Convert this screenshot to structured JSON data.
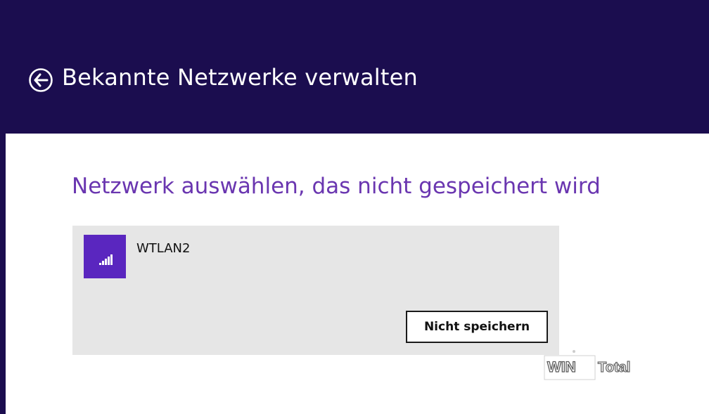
{
  "header": {
    "title": "Bekannte Netzwerke verwalten",
    "back_icon": "back-arrow-circle-icon",
    "background_color": "#1b0d4f"
  },
  "main": {
    "heading": "Netzwerk auswählen, das nicht gespeichert wird",
    "heading_color": "#6a36b0",
    "networks": [
      {
        "name": "WTLAN2",
        "icon": "wifi-signal-icon",
        "tile_color": "#5a26bf",
        "forget_label": "Nicht speichern"
      }
    ]
  },
  "watermark": {
    "text": "WIN Total"
  }
}
